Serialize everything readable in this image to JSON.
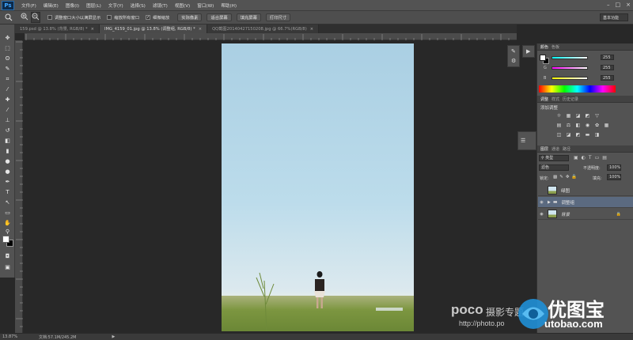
{
  "app": {
    "logo": "Ps"
  },
  "menu": [
    "文件(F)",
    "编辑(E)",
    "图像(I)",
    "图层(L)",
    "文字(Y)",
    "选择(S)",
    "滤镜(T)",
    "视图(V)",
    "窗口(W)",
    "帮助(H)"
  ],
  "window_controls": [
    "–",
    "□",
    "×"
  ],
  "options_bar": {
    "resize_windows": "调整窗口大小以满屏显示",
    "zoom_all": "缩放所有窗口",
    "scrubby_zoom": "细微缩放",
    "actual_pixels": "实际像素",
    "fit_screen": "适合屏幕",
    "fill_screen": "填充屏幕",
    "print_size": "打印尺寸",
    "workspace": "基本功能"
  },
  "tabs": [
    {
      "label": "159.psd @ 13.8% (背景, RGB/8) *",
      "active": false
    },
    {
      "label": "IMG_4159_01.jpg @ 13.8% (调整组, RGB/8) *",
      "active": true
    },
    {
      "label": "QQ截图20140427150208.jpg @ 66.7%(RGB/8)",
      "active": false
    }
  ],
  "color_panel": {
    "tabs": [
      "颜色",
      "色板"
    ],
    "channels": [
      {
        "label": "R",
        "value": "255"
      },
      {
        "label": "G",
        "value": "255"
      },
      {
        "label": "B",
        "value": "255"
      }
    ]
  },
  "adjustments_panel": {
    "tabs": [
      "调整",
      "样式",
      "历史记录"
    ],
    "title": "添加调整"
  },
  "layers_panel": {
    "tabs": [
      "图层",
      "通道",
      "路径"
    ],
    "kind": "类型",
    "blend_mode": "滤色",
    "opacity_label": "不透明度:",
    "opacity": "100%",
    "lock_label": "锁定:",
    "fill_label": "填充:",
    "fill": "100%",
    "layers": [
      {
        "name": "绿图",
        "visible": false,
        "type": "image"
      },
      {
        "name": "调整组",
        "visible": true,
        "type": "group"
      },
      {
        "name": "背景",
        "visible": true,
        "type": "background"
      }
    ]
  },
  "status": {
    "zoom": "13.87%",
    "doc": "文档:57.1M/245.2M"
  },
  "watermarks": {
    "poco_brand": "poco",
    "poco_text": "摄影专题",
    "poco_url": "http://photo.po",
    "utobao_name": "优图宝",
    "utobao_url": "utobao.com"
  }
}
